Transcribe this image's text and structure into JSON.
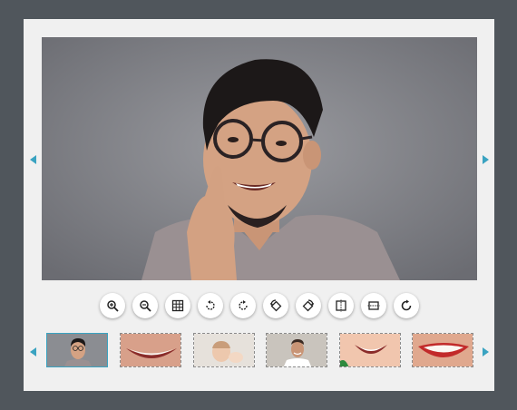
{
  "viewer": {
    "main_image": "man-with-glasses-smiling-finger-on-cheek",
    "prev_icon": "triangle-left-icon",
    "next_icon": "triangle-right-icon"
  },
  "toolbar": {
    "buttons": [
      {
        "icon": "zoom-in-icon"
      },
      {
        "icon": "zoom-out-icon"
      },
      {
        "icon": "grid-one-to-one-icon"
      },
      {
        "icon": "rotate-left-icon"
      },
      {
        "icon": "rotate-right-icon"
      },
      {
        "icon": "rotate-left-alt-icon"
      },
      {
        "icon": "rotate-right-alt-icon"
      },
      {
        "icon": "flip-horizontal-icon"
      },
      {
        "icon": "flip-vertical-icon"
      },
      {
        "icon": "reset-icon"
      }
    ]
  },
  "thumbnails": [
    {
      "subject": "man-with-glasses",
      "active": true
    },
    {
      "subject": "smile-closeup",
      "active": false
    },
    {
      "subject": "baby-smiling",
      "active": false
    },
    {
      "subject": "man-smiling-white-shirt",
      "active": false
    },
    {
      "subject": "child-smile-closeup",
      "active": false
    },
    {
      "subject": "red-lips-smile",
      "active": false
    }
  ],
  "colors": {
    "accent": "#3aa3c1",
    "page_background": "#50565c",
    "panel_background": "#f0f0f0"
  }
}
